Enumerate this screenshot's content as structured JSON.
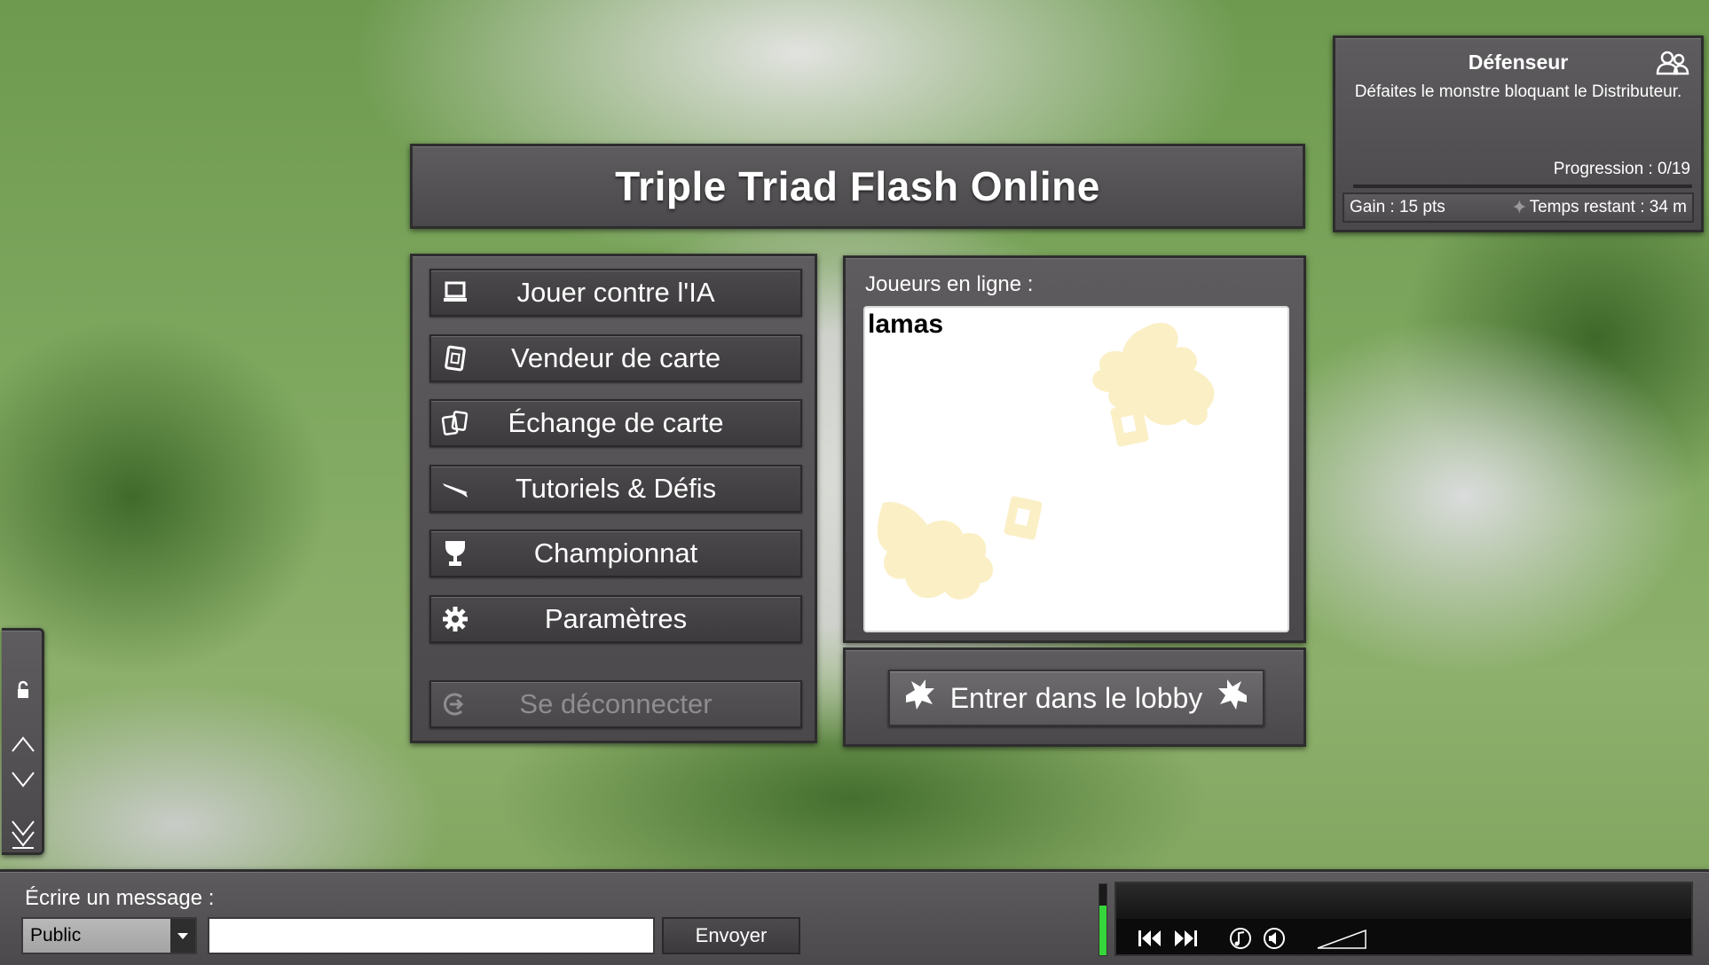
{
  "app": {
    "title": "Triple Triad Flash Online"
  },
  "menu": {
    "items": [
      {
        "label": "Jouer contre l'IA",
        "icon": "laptop-icon"
      },
      {
        "label": "Vendeur de carte",
        "icon": "card-icon"
      },
      {
        "label": "Échange de carte",
        "icon": "cards-exchange-icon"
      },
      {
        "label": "Tutoriels & Défis",
        "icon": "quill-icon"
      },
      {
        "label": "Championnat",
        "icon": "trophy-icon"
      },
      {
        "label": "Paramètres",
        "icon": "gear-icon"
      },
      {
        "label": "Se déconnecter",
        "icon": "logout-icon"
      }
    ]
  },
  "online": {
    "heading": "Joueurs en ligne :",
    "players": [
      "lamas"
    ],
    "lobby_button": "Entrer dans le lobby"
  },
  "quest": {
    "title": "Défenseur",
    "description": "Défaites le monstre bloquant le Distributeur.",
    "progress_text": "Progression : 0/19",
    "progress_fraction": 0,
    "gain": "Gain : 15 pts",
    "time_left": "Temps restant : 34 m"
  },
  "chat": {
    "label": "Écrire un message :",
    "channel": "Public",
    "input_value": "",
    "send_label": "Envoyer"
  },
  "music": {
    "volume_fraction": 0.7
  },
  "colors": {
    "panel": "#4f4d4f",
    "progress": "#8be05a",
    "music_level": "#36d63a",
    "watermark": "#fbefc6"
  }
}
